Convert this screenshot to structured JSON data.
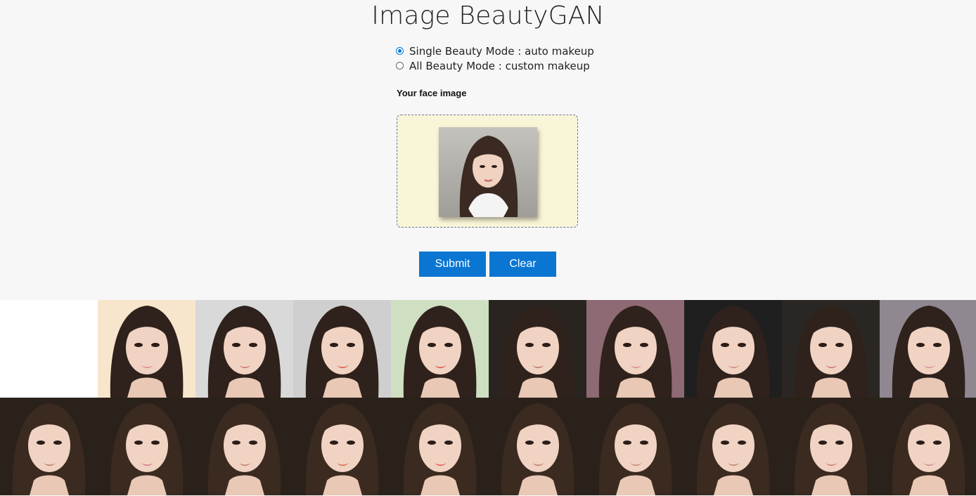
{
  "page": {
    "title": "Image BeautyGAN"
  },
  "modes": [
    {
      "label": "Single Beauty Mode : auto makeup",
      "checked": true
    },
    {
      "label": "All Beauty Mode : custom makeup",
      "checked": false
    }
  ],
  "upload": {
    "label": "Your face image"
  },
  "buttons": {
    "submit": "Submit",
    "clear": "Clear"
  },
  "colors": {
    "accent": "#0a76d2",
    "dropzone_bg": "#f9f5d7",
    "page_bg": "#f7f7f7"
  },
  "reference_faces": [
    {
      "name": "blank",
      "bg": "#ffffff"
    },
    {
      "name": "ref-1",
      "bg": "#f7e6cc"
    },
    {
      "name": "ref-2",
      "bg": "#d9d9d9"
    },
    {
      "name": "ref-3",
      "bg": "#cfcfcf"
    },
    {
      "name": "ref-4",
      "bg": "#cfe0c2"
    },
    {
      "name": "ref-5",
      "bg": "#2a2420"
    },
    {
      "name": "ref-6",
      "bg": "#8d6a74"
    },
    {
      "name": "ref-7",
      "bg": "#1f1f1f"
    },
    {
      "name": "ref-8",
      "bg": "#2a2623"
    },
    {
      "name": "ref-9",
      "bg": "#8f8890"
    }
  ],
  "result_faces": [
    {
      "lip": "#b86c64"
    },
    {
      "lip": "#d96a86"
    },
    {
      "lip": "#c3746a"
    },
    {
      "lip": "#d9583f"
    },
    {
      "lip": "#e04a3c"
    },
    {
      "lip": "#be7466"
    },
    {
      "lip": "#c27f78"
    },
    {
      "lip": "#b97560"
    },
    {
      "lip": "#d26a78"
    },
    {
      "lip": "#d07e90"
    }
  ]
}
